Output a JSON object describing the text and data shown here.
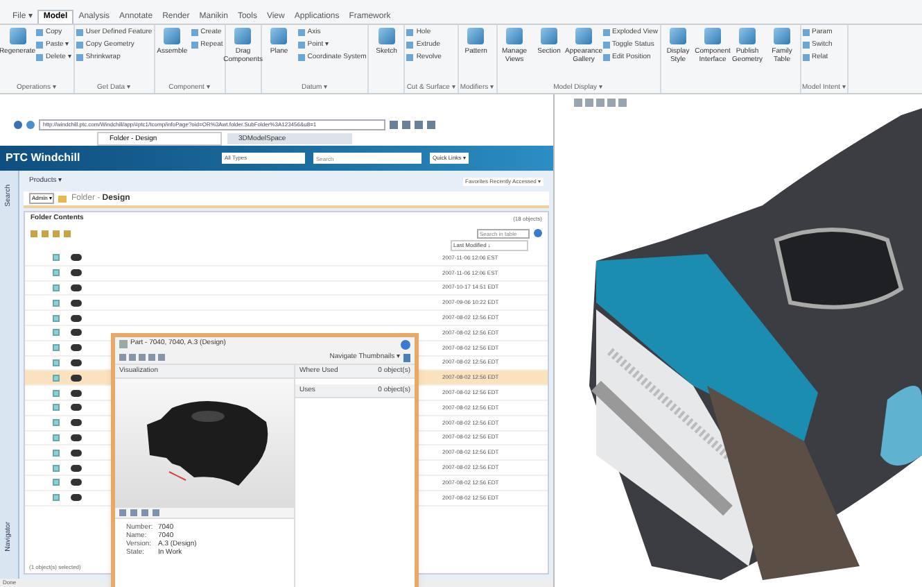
{
  "ribbon": {
    "tabs": [
      {
        "label": "File ▾",
        "selected": false
      },
      {
        "label": "Model",
        "selected": true
      },
      {
        "label": "Analysis",
        "selected": false
      },
      {
        "label": "Annotate",
        "selected": false
      },
      {
        "label": "Render",
        "selected": false
      },
      {
        "label": "Manikin",
        "selected": false
      },
      {
        "label": "Tools",
        "selected": false
      },
      {
        "label": "View",
        "selected": false
      },
      {
        "label": "Applications",
        "selected": false
      },
      {
        "label": "Framework",
        "selected": false
      }
    ],
    "groups": [
      {
        "label": "Operations ▾",
        "large": [
          "Regenerate"
        ],
        "small": [
          "Copy",
          "Paste ▾",
          "Delete ▾"
        ]
      },
      {
        "label": "Get Data ▾",
        "small": [
          "User Defined Feature",
          "Copy Geometry",
          "Shrinkwrap"
        ]
      },
      {
        "label": "Component ▾",
        "large": [
          "Assemble"
        ],
        "small": [
          "Create",
          "Repeat"
        ]
      },
      {
        "large": [
          "Drag Components"
        ]
      },
      {
        "label": "Datum ▾",
        "large": [
          "Plane"
        ],
        "small": [
          "Axis",
          "Point ▾",
          "Coordinate System"
        ]
      },
      {
        "large": [
          "Sketch"
        ]
      },
      {
        "label": "Cut & Surface ▾",
        "small": [
          "Hole",
          "Extrude",
          "Revolve"
        ]
      },
      {
        "label": "Modifiers ▾",
        "large": [
          "Pattern"
        ]
      },
      {
        "label": "Model Display ▾",
        "large": [
          "Manage Views",
          "Section",
          "Appearance Gallery"
        ],
        "small": [
          "Exploded View",
          "Toggle Status",
          "Edit Position"
        ]
      },
      {
        "large": [
          "Display Style",
          "Component Interface",
          "Publish Geometry",
          "Family Table"
        ]
      },
      {
        "label": "Model Intent ▾",
        "small": [
          "Param",
          "Switch",
          "Relat"
        ]
      }
    ]
  },
  "browser": {
    "address": "http://windchill.ptc.com/Windchill/app/#ptc1/tcomp/infoPage?oid=OR%3Awt.folder.SubFolder%3A123456&u8=1",
    "tabs": [
      {
        "label": "Folder - Design",
        "selected": true
      },
      {
        "label": "3DModelSpace",
        "selected": false
      }
    ]
  },
  "windchill": {
    "logo": "PTC Windchill",
    "type_filter": "All Types",
    "search_placeholder": "Search",
    "quick_links": "Quick Links ▾",
    "nav": "Products ▾",
    "favorites": "Favorites  Recently Accessed ▾",
    "context": "Admin ▾",
    "breadcrumb_prefix": "Folder - ",
    "breadcrumb": "Design",
    "section": "Folder Contents",
    "count": "(18 objects)",
    "filter_placeholder": "Search in table",
    "column": "Last Modified ↓",
    "sidebar_tabs": [
      "Search",
      "Navigator"
    ],
    "rows": [
      {
        "date": "2007-11-06 12:06 EST",
        "selected": false
      },
      {
        "date": "2007-11-06 12:06 EST",
        "selected": false
      },
      {
        "date": "2007-10-17 14:51 EDT",
        "selected": false
      },
      {
        "date": "2007-09-06 10:22 EDT",
        "selected": false
      },
      {
        "date": "2007-08-02 12:56 EDT",
        "selected": false
      },
      {
        "date": "2007-08-02 12:56 EDT",
        "selected": false
      },
      {
        "date": "2007-08-02 12:56 EDT",
        "selected": false
      },
      {
        "date": "2007-08-02 12:56 EDT",
        "selected": false
      },
      {
        "date": "2007-08-02 12:56 EDT",
        "selected": true
      },
      {
        "date": "2007-08-02 12:56 EDT",
        "selected": false
      },
      {
        "date": "2007-08-02 12:56 EDT",
        "selected": false
      },
      {
        "date": "2007-08-02 12:56 EDT",
        "selected": false
      },
      {
        "date": "2007-08-02 12:56 EDT",
        "selected": false
      },
      {
        "date": "2007-08-02 12:56 EDT",
        "selected": false
      },
      {
        "date": "2007-08-02 12:56 EDT",
        "selected": false
      },
      {
        "date": "2007-08-02 12:56 EDT",
        "selected": false
      },
      {
        "date": "2007-08-02 12:56 EDT",
        "selected": false
      }
    ],
    "footer": "(1 object(s) selected)"
  },
  "popup": {
    "title": "Part - 7040, 7040, A.3 (Design)",
    "thumbnails": "Navigate Thumbnails ▾",
    "visualization": "Visualization",
    "where_used": "Where Used",
    "where_used_count": "0 object(s)",
    "uses": "Uses",
    "uses_count": "0 object(s)",
    "attributes": [
      {
        "name": "Number:",
        "value": "7040"
      },
      {
        "name": "Name:",
        "value": "7040"
      },
      {
        "name": "Version:",
        "value": "A.3 (Design)"
      },
      {
        "name": "State:",
        "value": "In Work"
      }
    ]
  },
  "status_bar": "Done"
}
